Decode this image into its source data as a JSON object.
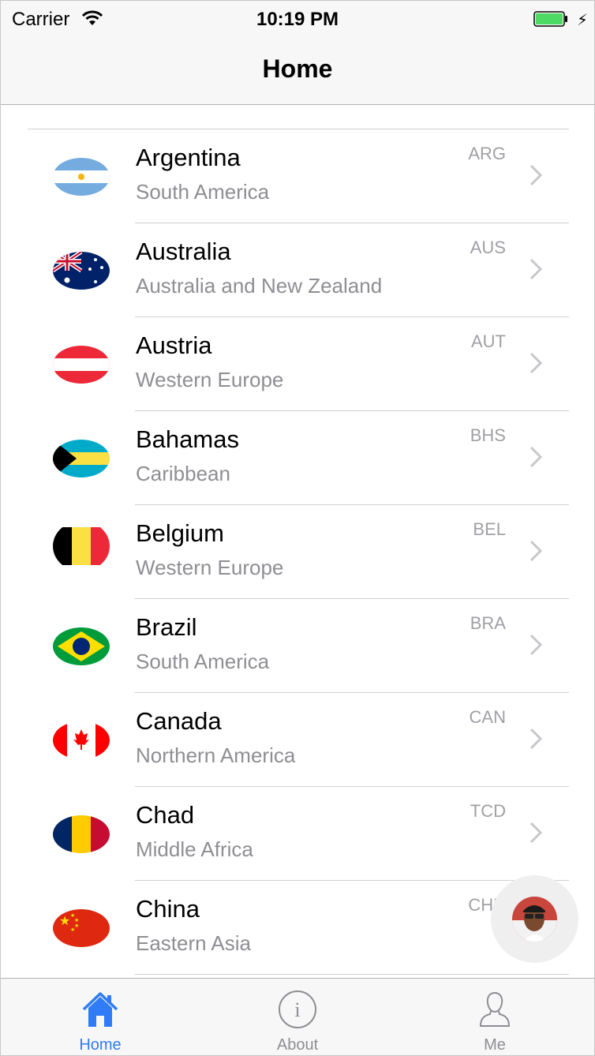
{
  "status_bar": {
    "carrier": "Carrier",
    "time": "10:19 PM"
  },
  "navbar": {
    "title": "Home"
  },
  "countries": [
    {
      "name": "Argentina",
      "region": "South America",
      "code": "ARG",
      "flag_icon": "argentina-flag-icon"
    },
    {
      "name": "Australia",
      "region": "Australia and New Zealand",
      "code": "AUS",
      "flag_icon": "australia-flag-icon"
    },
    {
      "name": "Austria",
      "region": "Western Europe",
      "code": "AUT",
      "flag_icon": "austria-flag-icon"
    },
    {
      "name": "Bahamas",
      "region": "Caribbean",
      "code": "BHS",
      "flag_icon": "bahamas-flag-icon"
    },
    {
      "name": "Belgium",
      "region": "Western Europe",
      "code": "BEL",
      "flag_icon": "belgium-flag-icon"
    },
    {
      "name": "Brazil",
      "region": "South America",
      "code": "BRA",
      "flag_icon": "brazil-flag-icon"
    },
    {
      "name": "Canada",
      "region": "Northern America",
      "code": "CAN",
      "flag_icon": "canada-flag-icon"
    },
    {
      "name": "Chad",
      "region": "Middle Africa",
      "code": "TCD",
      "flag_icon": "chad-flag-icon"
    },
    {
      "name": "China",
      "region": "Eastern Asia",
      "code": "CHN",
      "flag_icon": "china-flag-icon"
    }
  ],
  "tabbar": {
    "items": [
      {
        "label": "Home",
        "icon": "home-icon",
        "active": true
      },
      {
        "label": "About",
        "icon": "info-icon",
        "active": false
      },
      {
        "label": "Me",
        "icon": "person-icon",
        "active": false
      }
    ]
  },
  "colors": {
    "accent": "#2f7cf6",
    "secondary_text": "#8e8e93",
    "separator": "#d0d0d0"
  }
}
